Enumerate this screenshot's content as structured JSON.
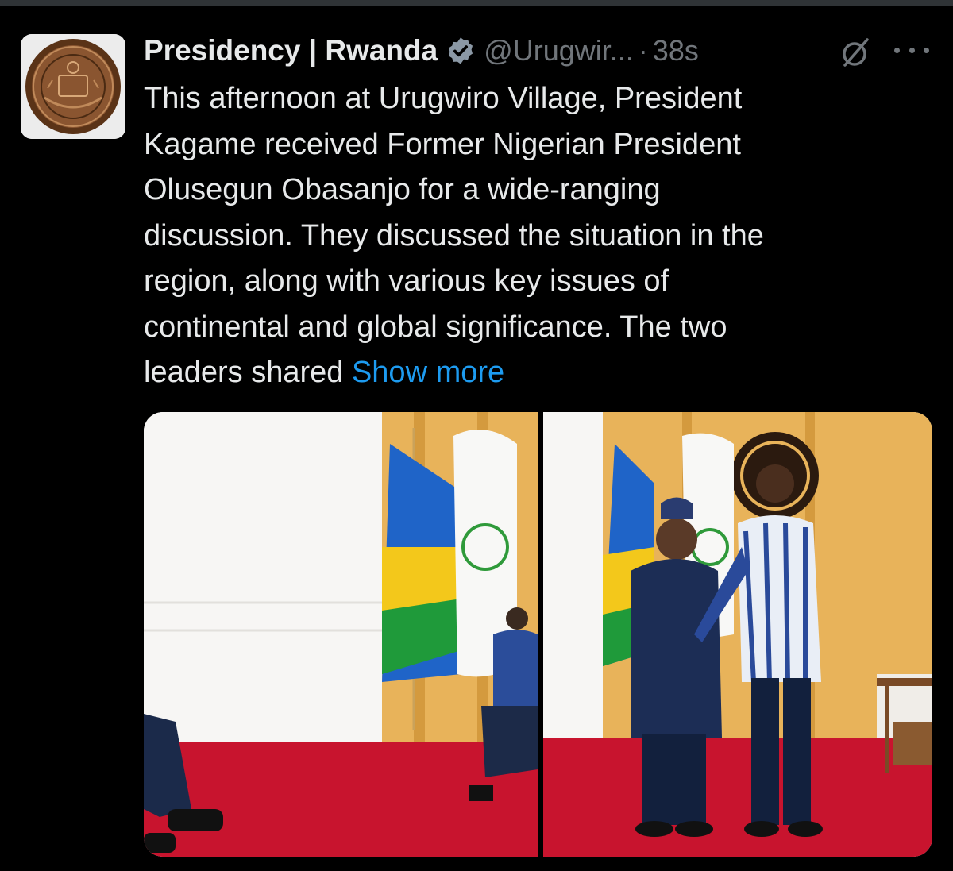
{
  "tweet": {
    "author": {
      "name": "Presidency | Rwanda",
      "handle": "@Urugwir...",
      "verified": true,
      "avatar_icon": "rwanda-coat-of-arms-seal"
    },
    "separator": "·",
    "timestamp": "38s",
    "text_lines": [
      "This afternoon at Urugwiro Village, President",
      "Kagame received Former Nigerian President",
      "Olusegun Obasanjo for a wide-ranging",
      "discussion. They discussed the situation in the",
      "region, along with various key issues of",
      "continental and global significance. The two",
      "leaders shared"
    ],
    "show_more_label": "Show more",
    "media": [
      {
        "description_icon": "photo-leaders-seated"
      },
      {
        "description_icon": "photo-leaders-handshake"
      }
    ]
  },
  "colors": {
    "background": "#000000",
    "text": "#e7e9ea",
    "secondary": "#71767b",
    "link": "#1d9bf0"
  }
}
